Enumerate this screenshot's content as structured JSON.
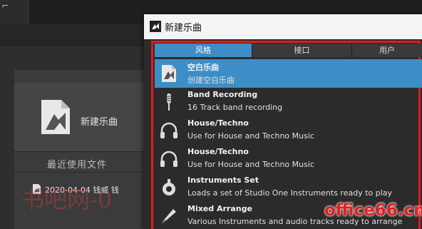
{
  "background_app": {
    "new_song_label": "新建乐曲",
    "recent_files_header": "最近使用文件",
    "recent_files": [
      {
        "label": "2020-04-04 钱威 钱"
      }
    ]
  },
  "dialog": {
    "title": "新建乐曲",
    "tabs": [
      {
        "label": "风格",
        "selected": true
      },
      {
        "label": "接口",
        "selected": false
      },
      {
        "label": "用户",
        "selected": false
      }
    ],
    "templates": [
      {
        "name": "空白乐曲",
        "description": "创建空白乐曲",
        "icon": "blank-song-icon",
        "selected": true
      },
      {
        "name": "Band Recording",
        "description": "16 Track band recording",
        "icon": "microphone-icon",
        "selected": false
      },
      {
        "name": "House/Techno",
        "description": "Use for House and Techno Music",
        "icon": "headphones-icon",
        "selected": false
      },
      {
        "name": "House/Techno",
        "description": "Use for House and Techno Music",
        "icon": "headphones-icon",
        "selected": false
      },
      {
        "name": "Instruments Set",
        "description": "Loads a set of Studio One Instruments ready to play",
        "icon": "instruments-icon",
        "selected": false
      },
      {
        "name": "Mixed Arrange",
        "description": "Various Instruments and audio tracks ready to arrange",
        "icon": "pen-icon",
        "selected": false
      }
    ]
  },
  "watermarks": {
    "left": "书吧网-0",
    "right": "office66.cn"
  },
  "colors": {
    "accent": "#3d8ec6",
    "highlight_frame": "#e21b1b",
    "dialog_bg": "#2b2b2b",
    "titlebar_bg": "#f4f4f4"
  }
}
